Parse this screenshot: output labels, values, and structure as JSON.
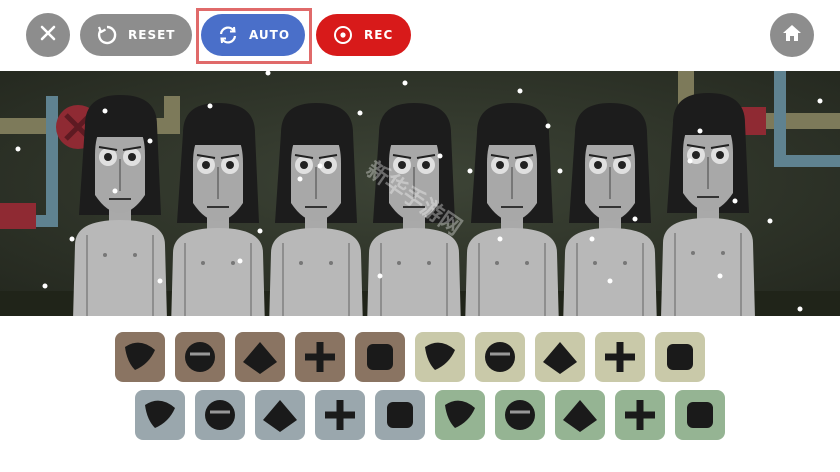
{
  "toolbar": {
    "reset_label": "RESET",
    "auto_label": "AUTO",
    "rec_label": "REC"
  },
  "icons": {
    "close": "close-icon",
    "reset": "reset-icon",
    "auto": "refresh-icon",
    "rec": "record-icon",
    "home": "home-icon"
  },
  "colors": {
    "auto": "#4a6fc9",
    "rec": "#d81a1a",
    "neutral": "#8d8d8d",
    "highlight": "#e06a6a"
  },
  "stage": {
    "character_count": 7
  },
  "sound_icons": {
    "row1": [
      {
        "name": "beat-1",
        "color": "#8a7462"
      },
      {
        "name": "beat-2",
        "color": "#8a7462"
      },
      {
        "name": "beat-3",
        "color": "#8a7462"
      },
      {
        "name": "beat-4",
        "color": "#8a7462"
      },
      {
        "name": "beat-5",
        "color": "#8a7462"
      },
      {
        "name": "effect-1",
        "color": "#c9c9a9"
      },
      {
        "name": "effect-2",
        "color": "#c9c9a9"
      },
      {
        "name": "effect-3",
        "color": "#c9c9a9"
      },
      {
        "name": "effect-4",
        "color": "#c9c9a9"
      },
      {
        "name": "effect-5",
        "color": "#c9c9a9"
      }
    ],
    "row2": [
      {
        "name": "melody-1",
        "color": "#9aa7ad"
      },
      {
        "name": "melody-2",
        "color": "#9aa7ad"
      },
      {
        "name": "melody-3",
        "color": "#9aa7ad"
      },
      {
        "name": "melody-4",
        "color": "#9aa7ad"
      },
      {
        "name": "melody-5",
        "color": "#9aa7ad"
      },
      {
        "name": "voice-1",
        "color": "#95b493"
      },
      {
        "name": "voice-2",
        "color": "#95b493"
      },
      {
        "name": "voice-3",
        "color": "#95b493"
      },
      {
        "name": "voice-4",
        "color": "#95b493"
      },
      {
        "name": "voice-5",
        "color": "#95b493"
      }
    ]
  }
}
